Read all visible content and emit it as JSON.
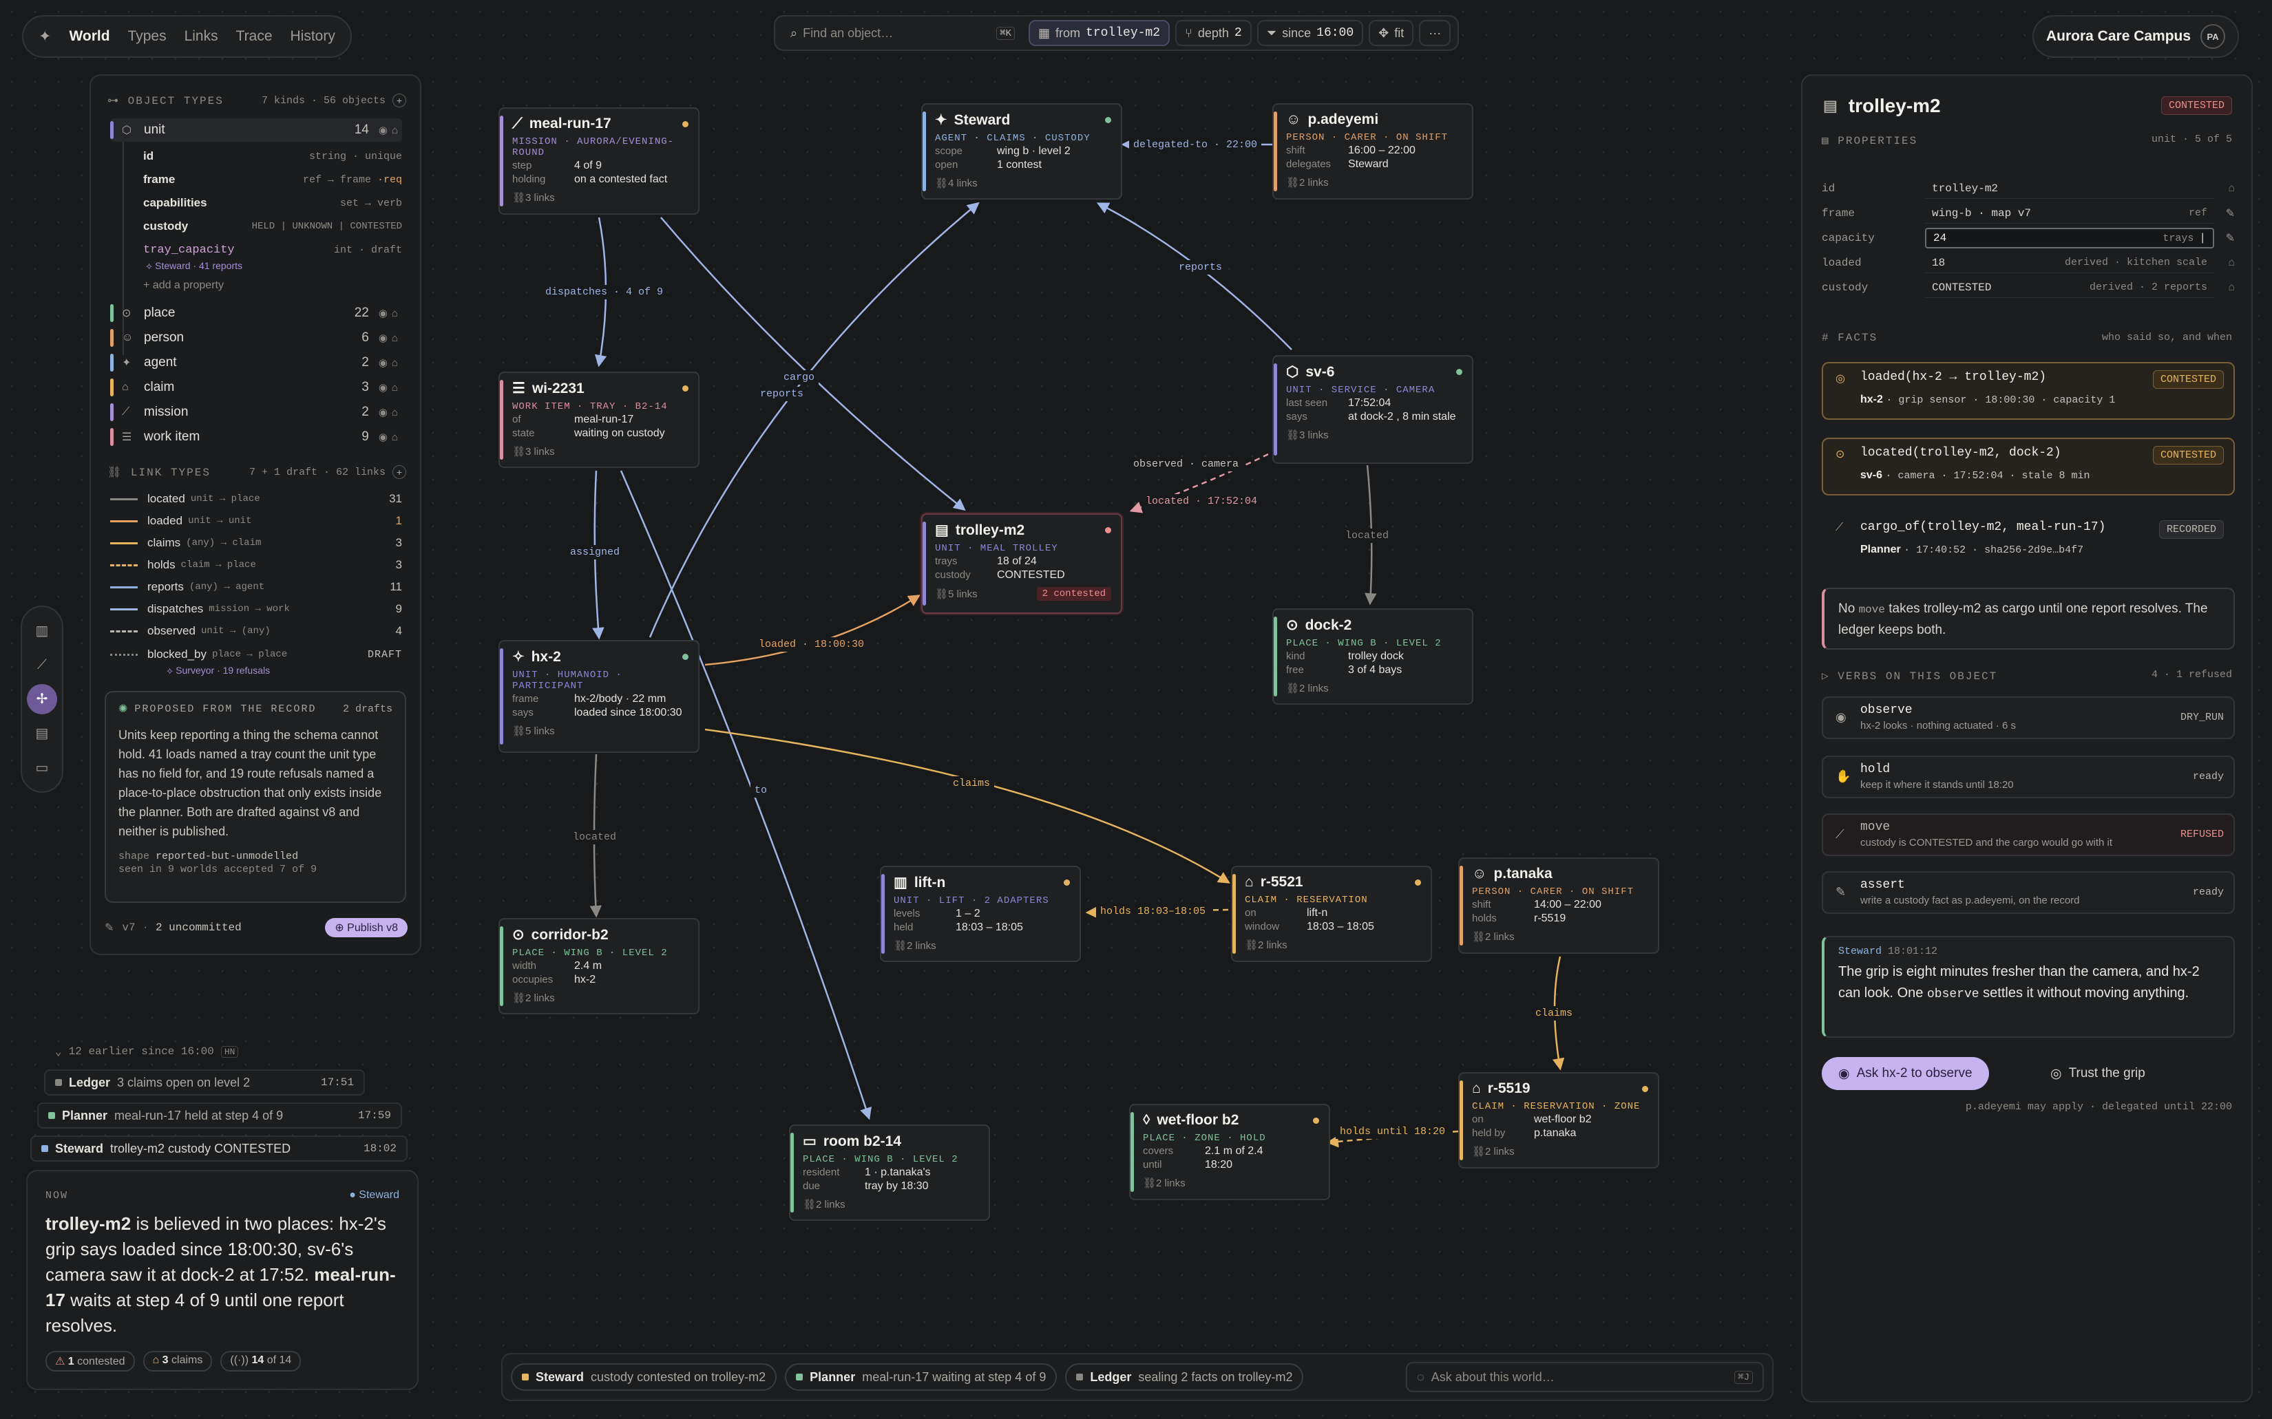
{
  "nav": {
    "tabs": [
      "World",
      "Types",
      "Links",
      "Trace",
      "History"
    ]
  },
  "toolbar": {
    "search_placeholder": "Find an object…",
    "search_kbd": "⌘K",
    "from_prefix": "from",
    "from": "trolley-m2",
    "depth_label": "depth",
    "depth": "2",
    "since_label": "since",
    "since": "16:00",
    "fit": "fit",
    "more": "···"
  },
  "campus": {
    "name": "Aurora Care Campus",
    "initials": "PA"
  },
  "object_types": {
    "header": "OBJECT TYPES",
    "summary": "7 kinds · 56 objects",
    "items": [
      {
        "name": "unit",
        "count": "14",
        "color": "#8f87d6"
      },
      {
        "name": "place",
        "count": "22",
        "color": "#7fc29b"
      },
      {
        "name": "person",
        "count": "6",
        "color": "#e0a06a"
      },
      {
        "name": "agent",
        "count": "2",
        "color": "#8fb3e0"
      },
      {
        "name": "claim",
        "count": "3",
        "color": "#e6b45f"
      },
      {
        "name": "mission",
        "count": "2",
        "color": "#a58fd6"
      },
      {
        "name": "work item",
        "count": "9",
        "color": "#d98f9f"
      }
    ],
    "unit_props": [
      {
        "k": "id",
        "v": "string · unique"
      },
      {
        "k": "frame",
        "v": "ref → frame ",
        "req": "·req"
      },
      {
        "k": "capabilities",
        "v": "set → verb"
      },
      {
        "k": "custody",
        "v": "HELD | UNKNOWN | CONTESTED"
      },
      {
        "k": "tray_capacity",
        "v": "int · draft"
      }
    ],
    "tray_note": "Steward · 41 reports",
    "add": "+ add a property"
  },
  "link_types": {
    "header": "LINK TYPES",
    "summary": "7 + 1 draft · 62 links",
    "items": [
      {
        "name": "located",
        "sig": "unit → place",
        "n": "31",
        "color": "#8a8883"
      },
      {
        "name": "loaded",
        "sig": "unit → unit",
        "n": "1",
        "color": "#e6a263"
      },
      {
        "name": "claims",
        "sig": "(any) → claim",
        "n": "3",
        "color": "#e6b45f"
      },
      {
        "name": "holds",
        "sig": "claim → place",
        "n": "3",
        "color": "#e6b45f"
      },
      {
        "name": "reports",
        "sig": "(any) → agent",
        "n": "11",
        "color": "#8fb3e0"
      },
      {
        "name": "dispatches",
        "sig": "mission → work",
        "n": "9",
        "color": "#9fb5e6"
      },
      {
        "name": "observed",
        "sig": "unit → (any)",
        "n": "4",
        "color": "#b9b6af"
      },
      {
        "name": "blocked_by",
        "sig": "place → place",
        "n": "DRAFT",
        "color": "#8a8883"
      }
    ],
    "blocked_note": "Surveyor · 19 refusals"
  },
  "proposal": {
    "title": "PROPOSED FROM THE RECORD",
    "drafts": "2 drafts",
    "text": "Units keep reporting a thing the schema cannot hold. 41 loads named a tray count the unit type has no field for, and 19 route refusals named a place-to-place obstruction that only exists inside the planner. Both are drafted against v8 and neither is published.",
    "shape_label": "shape",
    "shape": "reported-but-unmodelled",
    "seen": "seen in 9 worlds",
    "accepted": "accepted 7 of 9"
  },
  "version": {
    "v": "v7",
    "uncommitted": "2 uncommitted",
    "publish": "Publish v8"
  },
  "timeline": {
    "earlier": "12 earlier since 16:00",
    "kbd": "HN",
    "rows": [
      {
        "who": "Ledger",
        "msg": "3 claims open on level 2",
        "t": "17:51",
        "color": "#8a8883"
      },
      {
        "who": "Planner",
        "msg": "meal-run-17 held at step 4 of 9",
        "t": "17:59",
        "color": "#7fc29b"
      },
      {
        "who": "Steward",
        "msg": "trolley-m2 custody CONTESTED",
        "t": "18:02",
        "color": "#8fb3e0"
      }
    ]
  },
  "now": {
    "label": "NOW",
    "agent": "Steward",
    "text_html": "<b>trolley-m2</b> is believed in two places: hx-2's grip says loaded since 18:00:30, sv-6's camera saw it at dock-2 at 17:52. <b>meal-run-17</b> waits at step 4 of 9 until one report resolves.",
    "chips": [
      {
        "n": "1",
        "l": "contested"
      },
      {
        "n": "3",
        "l": "claims"
      },
      {
        "n": "14",
        "l": "of 14"
      }
    ]
  },
  "nodes": {
    "meal": {
      "title": "meal-run-17",
      "sub": "MISSION · AURORA/EVENING-ROUND",
      "f": [
        [
          "step",
          "4 of 9"
        ],
        [
          "holding",
          "on a contested fact"
        ]
      ],
      "links": "3 links"
    },
    "steward": {
      "title": "Steward",
      "sub": "AGENT · CLAIMS · CUSTODY",
      "f": [
        [
          "scope",
          "wing b · level 2"
        ],
        [
          "open",
          "1 contest"
        ]
      ],
      "links": "4 links"
    },
    "adeyemi": {
      "title": "p.adeyemi",
      "sub": "PERSON · CARER · ON SHIFT",
      "f": [
        [
          "shift",
          "16:00 – 22:00"
        ],
        [
          "delegates",
          "Steward"
        ]
      ],
      "links": "2 links"
    },
    "wi": {
      "title": "wi-2231",
      "sub": "WORK ITEM · TRAY · B2-14",
      "f": [
        [
          "of",
          "meal-run-17"
        ],
        [
          "state",
          "waiting on custody"
        ]
      ],
      "links": "3 links"
    },
    "sv6": {
      "title": "sv-6",
      "sub": "UNIT · SERVICE · CAMERA",
      "f": [
        [
          "last seen",
          "17:52:04"
        ],
        [
          "says",
          "at dock-2 , 8 min stale"
        ]
      ],
      "links": "3 links"
    },
    "trolley": {
      "title": "trolley-m2",
      "sub": "UNIT · MEAL TROLLEY",
      "f": [
        [
          "trays",
          "18 of 24"
        ],
        [
          "custody",
          "CONTESTED"
        ]
      ],
      "links": "5 links",
      "contested": "2 contested"
    },
    "dock": {
      "title": "dock-2",
      "sub": "PLACE · WING B · LEVEL 2",
      "f": [
        [
          "kind",
          "trolley dock"
        ],
        [
          "free",
          "3 of 4 bays"
        ]
      ],
      "links": "2 links"
    },
    "hx2": {
      "title": "hx-2",
      "sub": "UNIT · HUMANOID · PARTICIPANT",
      "f": [
        [
          "frame",
          "hx-2/body · 22 mm"
        ],
        [
          "says",
          "loaded since 18:00:30"
        ]
      ],
      "links": "5 links"
    },
    "lift": {
      "title": "lift-n",
      "sub": "UNIT · LIFT · 2 ADAPTERS",
      "f": [
        [
          "levels",
          "1 – 2"
        ],
        [
          "held",
          "18:03 – 18:05"
        ]
      ],
      "links": "2 links"
    },
    "r5521": {
      "title": "r-5521",
      "sub": "CLAIM · RESERVATION",
      "f": [
        [
          "on",
          "lift-n"
        ],
        [
          "window",
          "18:03 – 18:05"
        ]
      ],
      "links": "2 links"
    },
    "tanaka": {
      "title": "p.tanaka",
      "sub": "PERSON · CARER · ON SHIFT",
      "f": [
        [
          "shift",
          "14:00 – 22:00"
        ],
        [
          "holds",
          "r-5519"
        ]
      ],
      "links": "2 links"
    },
    "corridor": {
      "title": "corridor-b2",
      "sub": "PLACE · WING B · LEVEL 2",
      "f": [
        [
          "width",
          "2.4 m"
        ],
        [
          "occupies",
          "hx-2"
        ]
      ],
      "links": "2 links"
    },
    "room": {
      "title": "room b2-14",
      "sub": "PLACE · WING B · LEVEL 2",
      "f": [
        [
          "resident",
          "1 · p.tanaka's"
        ],
        [
          "due",
          "tray by 18:30"
        ]
      ],
      "links": "2 links"
    },
    "wet": {
      "title": "wet-floor b2",
      "sub": "PLACE · ZONE · HOLD",
      "f": [
        [
          "covers",
          "2.1 m of 2.4"
        ],
        [
          "until",
          "18:20"
        ]
      ],
      "links": "2 links"
    },
    "r5519": {
      "title": "r-5519",
      "sub": "CLAIM · RESERVATION · ZONE",
      "f": [
        [
          "on",
          "wet-floor b2"
        ],
        [
          "held by",
          "p.tanaka"
        ]
      ],
      "links": "2 links"
    }
  },
  "edges": {
    "delegated": "delegated-to · 22:00",
    "dispatches": "dispatches · 4 of 9",
    "cargo": "cargo",
    "reports1": "reports",
    "reports2": "reports",
    "observed": "observed · camera",
    "located_ts": "located · 17:52:04",
    "located1": "located",
    "located2": "located",
    "assigned": "assigned",
    "loaded": "loaded · 18:00:30",
    "claims1": "claims",
    "claims2": "claims",
    "to": "to",
    "holds1": "holds 18:03–18:05",
    "holds2": "holds until 18:20"
  },
  "inspector": {
    "title": "trolley-m2",
    "status": "CONTESTED",
    "props_header": "PROPERTIES",
    "props_meta": "unit · 5 of 5",
    "props": [
      {
        "k": "id",
        "v": "trolley-m2",
        "s": ""
      },
      {
        "k": "frame",
        "v": "wing-b · map v7",
        "s": "ref"
      },
      {
        "k": "capacity",
        "v": "24",
        "s": "trays"
      },
      {
        "k": "loaded",
        "v": "18",
        "s": "derived · kitchen scale"
      },
      {
        "k": "custody",
        "v": "CONTESTED",
        "s": "derived · 2 reports"
      }
    ],
    "facts_header": "FACTS",
    "facts_meta": "who said so, and when",
    "facts": [
      {
        "f": "loaded(hx-2 → trolley-m2)",
        "src": "hx-2",
        "meta": "· grip sensor · 18:00:30 · capacity 1",
        "badge": "CONTESTED"
      },
      {
        "f": "located(trolley-m2, dock-2)",
        "src": "sv-6",
        "meta": "· camera · 17:52:04 · stale 8 min",
        "badge": "CONTESTED"
      },
      {
        "f": "cargo_of(trolley-m2, meal-run-17)",
        "src": "Planner",
        "meta": "· 17:40:52 · sha256-2d9e…b4f7",
        "badge": "RECORDED"
      }
    ],
    "note_pre": "No ",
    "note_code": "move",
    "note_post": " takes trolley-m2 as cargo until one report resolves. The ledger keeps both.",
    "verbs_header": "VERBS ON THIS OBJECT",
    "verbs_meta": "4 · 1 refused",
    "verbs": [
      {
        "a": "observe",
        "b": "hx-2 looks · nothing actuated · 6 s",
        "st": "DRY_RUN"
      },
      {
        "a": "hold",
        "b": "keep it where it stands until 18:20",
        "st": "ready"
      },
      {
        "a": "move",
        "b": "custody is CONTESTED and the cargo would go with it",
        "st": "REFUSED"
      },
      {
        "a": "assert",
        "b": "write a custody fact as p.adeyemi, on the record",
        "st": "ready"
      }
    ],
    "msg_who": "Steward",
    "msg_time": "18:01:12",
    "msg_pre": "The grip is eight minutes fresher than the camera, and hx-2 can look. One ",
    "msg_code": "observe",
    "msg_post": " settles it without moving anything.",
    "ask": "Ask hx-2 to observe",
    "trust": "Trust the grip",
    "foot": "p.adeyemi may apply · delegated until 22:00"
  },
  "bottom": {
    "items": [
      {
        "who": "Steward",
        "msg": "custody contested on trolley-m2",
        "color": "#e6b45f"
      },
      {
        "who": "Planner",
        "msg": "meal-run-17 waiting at step 4 of 9",
        "color": "#7fc29b"
      },
      {
        "who": "Ledger",
        "msg": "sealing 2 facts on trolley-m2",
        "color": "#8a8883"
      }
    ],
    "ask_placeholder": "Ask about this world…",
    "ask_kbd": "⌘J"
  }
}
